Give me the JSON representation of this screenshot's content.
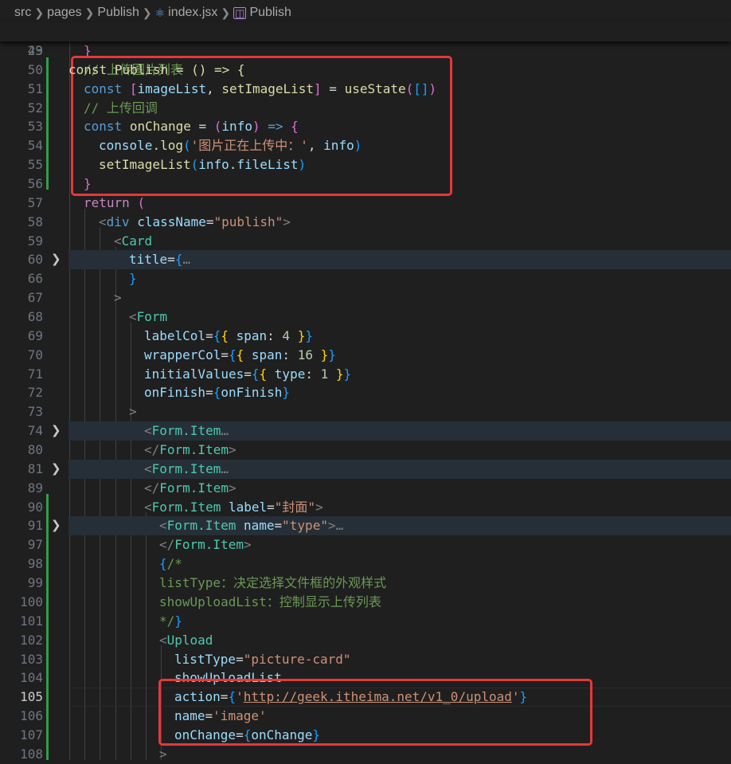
{
  "breadcrumb": {
    "items": [
      "src",
      "pages",
      "Publish",
      "index.jsx",
      "Publish"
    ],
    "icons": [
      "react-icon",
      "symbol-icon"
    ]
  },
  "sticky": {
    "line_number": "23",
    "code": "const Publish = () => {"
  },
  "lines": [
    {
      "n": "49",
      "code": "}"
    },
    {
      "n": "50",
      "code": "// 上传图片列表"
    },
    {
      "n": "51",
      "code": "const [imageList, setImageList] = useState([])"
    },
    {
      "n": "52",
      "code": "// 上传回调"
    },
    {
      "n": "53",
      "code": "const onChange = (info) => {"
    },
    {
      "n": "54",
      "code": "console.log('图片正在上传中：', info)"
    },
    {
      "n": "55",
      "code": "setImageList(info.fileList)"
    },
    {
      "n": "56",
      "code": "}"
    },
    {
      "n": "57",
      "code": "return ("
    },
    {
      "n": "58",
      "code": "<div className=\"publish\">"
    },
    {
      "n": "59",
      "code": "<Card"
    },
    {
      "n": "60",
      "code": "title={…"
    },
    {
      "n": "66",
      "code": "}"
    },
    {
      "n": "67",
      "code": ">"
    },
    {
      "n": "68",
      "code": "<Form"
    },
    {
      "n": "69",
      "code": "labelCol={{ span: 4 }}"
    },
    {
      "n": "70",
      "code": "wrapperCol={{ span: 16 }}"
    },
    {
      "n": "71",
      "code": "initialValues={{ type: 1 }}"
    },
    {
      "n": "72",
      "code": "onFinish={onFinish}"
    },
    {
      "n": "73",
      "code": ">"
    },
    {
      "n": "74",
      "code": "<Form.Item…"
    },
    {
      "n": "80",
      "code": "</Form.Item>"
    },
    {
      "n": "81",
      "code": "<Form.Item…"
    },
    {
      "n": "89",
      "code": "</Form.Item>"
    },
    {
      "n": "90",
      "code": "<Form.Item label=\"封面\">"
    },
    {
      "n": "91",
      "code": "<Form.Item name=\"type\">…"
    },
    {
      "n": "97",
      "code": "</Form.Item>"
    },
    {
      "n": "98",
      "code": "{/*"
    },
    {
      "n": "99",
      "code": "listType：决定选择文件框的外观样式"
    },
    {
      "n": "100",
      "code": "showUploadList：控制显示上传列表"
    },
    {
      "n": "101",
      "code": "*/}"
    },
    {
      "n": "102",
      "code": "<Upload"
    },
    {
      "n": "103",
      "code": "listType=\"picture-card\""
    },
    {
      "n": "104",
      "code": "showUploadList"
    },
    {
      "n": "105",
      "code": "action={'http://geek.itheima.net/v1_0/upload'}"
    },
    {
      "n": "106",
      "code": "name='image'"
    },
    {
      "n": "107",
      "code": "onChange={onChange}"
    },
    {
      "n": "108",
      "code": ">"
    }
  ],
  "theme": {
    "background": "#1f1f1f",
    "highlight": "#262f37",
    "annotation": "#e5383b",
    "git_added": "#2ea043"
  }
}
